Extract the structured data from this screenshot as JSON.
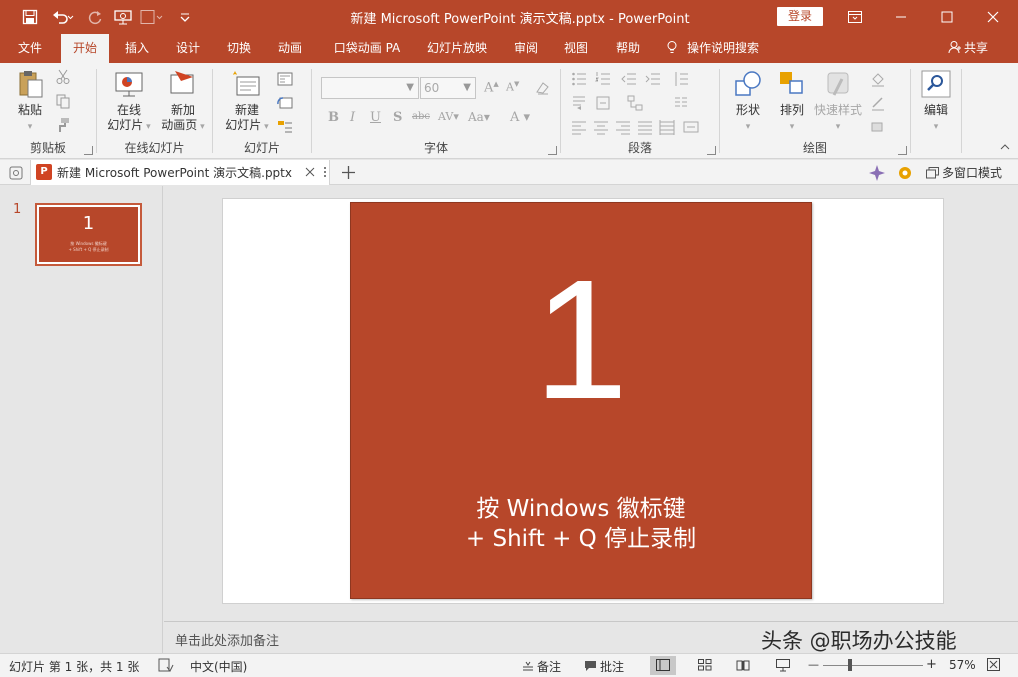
{
  "app": {
    "title": "新建 Microsoft PowerPoint 演示文稿.pptx  -  PowerPoint",
    "login_label": "登录",
    "accent": "#b7472a"
  },
  "quick_access": [
    "save-icon",
    "undo-icon",
    "redo-icon",
    "present-from-start-icon",
    "new-slide-icon",
    "customize-icon"
  ],
  "ribbon_tabs": [
    {
      "label": "文件"
    },
    {
      "label": "开始"
    },
    {
      "label": "插入"
    },
    {
      "label": "设计"
    },
    {
      "label": "切换"
    },
    {
      "label": "动画"
    },
    {
      "label": "口袋动画 PA"
    },
    {
      "label": "幻灯片放映"
    },
    {
      "label": "审阅"
    },
    {
      "label": "视图"
    },
    {
      "label": "帮助"
    }
  ],
  "active_tab": "开始",
  "tell_me": "操作说明搜索",
  "share": "共享",
  "ribbon": {
    "clipboard": {
      "paste": "粘贴",
      "label": "剪贴板"
    },
    "online_slides": {
      "online_slide_l1": "在线",
      "online_slide_l2": "幻灯片",
      "new_anim_l1": "新加",
      "new_anim_l2": "动画页",
      "label": "在线幻灯片"
    },
    "slides": {
      "new_slide_l1": "新建",
      "new_slide_l2": "幻灯片",
      "label": "幻灯片"
    },
    "font": {
      "size": "60",
      "label": "字体"
    },
    "paragraph": {
      "label": "段落"
    },
    "drawing": {
      "shapes": "形状",
      "arrange": "排列",
      "quick_styles": "快速样式",
      "label": "绘图"
    },
    "editing": {
      "label": "编辑"
    }
  },
  "doc_tab": {
    "label": "新建 Microsoft PowerPoint 演示文稿.pptx",
    "multi_window": "多窗口模式"
  },
  "slides": [
    {
      "number": "1",
      "big_number": "1",
      "line1": "按 Windows 徽标键",
      "line2": "+ Shift + Q 停止录制"
    }
  ],
  "notes_placeholder": "单击此处添加备注",
  "watermark": "头条 @职场办公技能",
  "status": {
    "slide_info": "幻灯片 第 1 张，共 1 张",
    "language": "中文(中国)",
    "notes": "备注",
    "comments": "批注",
    "zoom": "57%",
    "zoom_minus": "—",
    "zoom_plus": "+"
  }
}
